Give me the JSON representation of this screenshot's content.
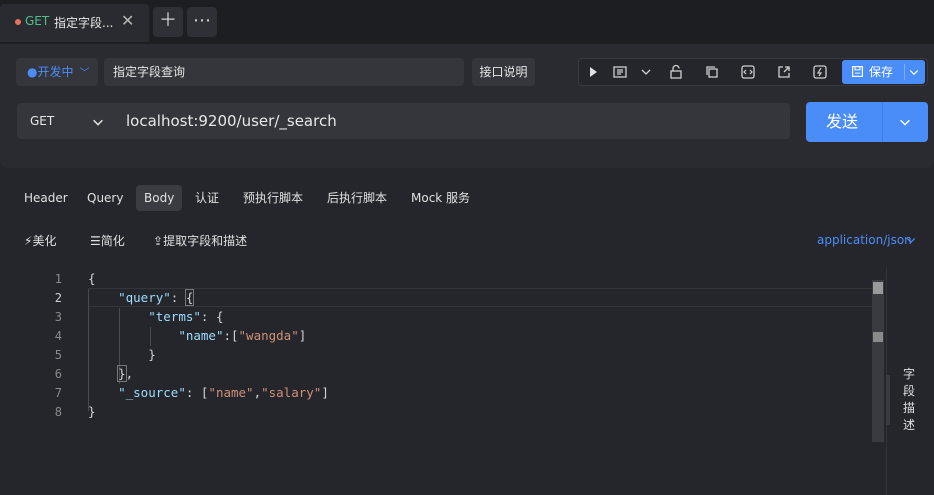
{
  "tab": {
    "method": "GET",
    "title": "指定字段..."
  },
  "header": {
    "environment": "开发中",
    "api_name": "指定字段查询",
    "doc_button": "接口说明",
    "save_label": "保存",
    "method": "GET",
    "url": "localhost:9200/user/_search",
    "send_label": "发送"
  },
  "request_tabs": [
    "Header",
    "Query",
    "Body",
    "认证",
    "预执行脚本",
    "后执行脚本",
    "Mock 服务"
  ],
  "body_actions": {
    "beautify": "美化",
    "simplify": "简化",
    "extract": "提取字段和描述"
  },
  "content_type": "application/json",
  "editor": {
    "line_numbers": [
      "1",
      "2",
      "3",
      "4",
      "5",
      "6",
      "7",
      "8"
    ]
  },
  "side_panel_label": "字段描述",
  "colors": {
    "accent": "#4b8df8",
    "method_get": "#4fc08d",
    "json_key": "#9cdcfe",
    "json_string": "#ce9178"
  }
}
